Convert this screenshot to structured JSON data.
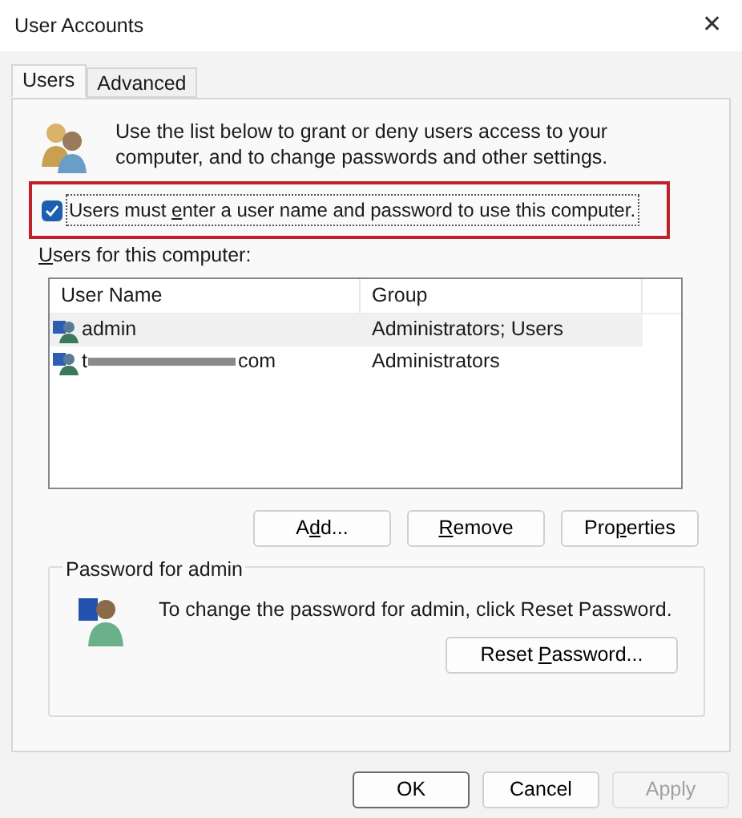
{
  "window": {
    "title": "User Accounts",
    "close": "✕"
  },
  "tabs": [
    {
      "label": "Users",
      "selected": true
    },
    {
      "label": "Advanced",
      "selected": false
    }
  ],
  "intro": "Use the list below to grant or deny users access to your computer, and to change passwords and other settings.",
  "must_login": {
    "label": "Users must enter a user name and password to use this computer.",
    "checked": true,
    "highlighted": true
  },
  "users_label": {
    "text": "Users for this computer:"
  },
  "table": {
    "columns": [
      "User Name",
      "Group"
    ],
    "rows": [
      {
        "prefix": "admin",
        "redacted": false,
        "suffix": "",
        "group": "Administrators; Users",
        "selected": true
      },
      {
        "prefix": "t",
        "redacted": true,
        "suffix": "com",
        "group": "Administrators",
        "selected": false
      }
    ]
  },
  "list_buttons": [
    {
      "label": "Add..."
    },
    {
      "label": "Remove"
    },
    {
      "label": "Properties"
    }
  ],
  "password_group": {
    "title": "Password for admin",
    "text": "To change the password for admin, click Reset Password.",
    "button": {
      "label": "Reset Password..."
    }
  },
  "footer_buttons": [
    {
      "label": "OK",
      "disabled": false,
      "default": true
    },
    {
      "label": "Cancel",
      "disabled": false,
      "default": false
    },
    {
      "label": "Apply",
      "disabled": true,
      "default": false
    }
  ]
}
